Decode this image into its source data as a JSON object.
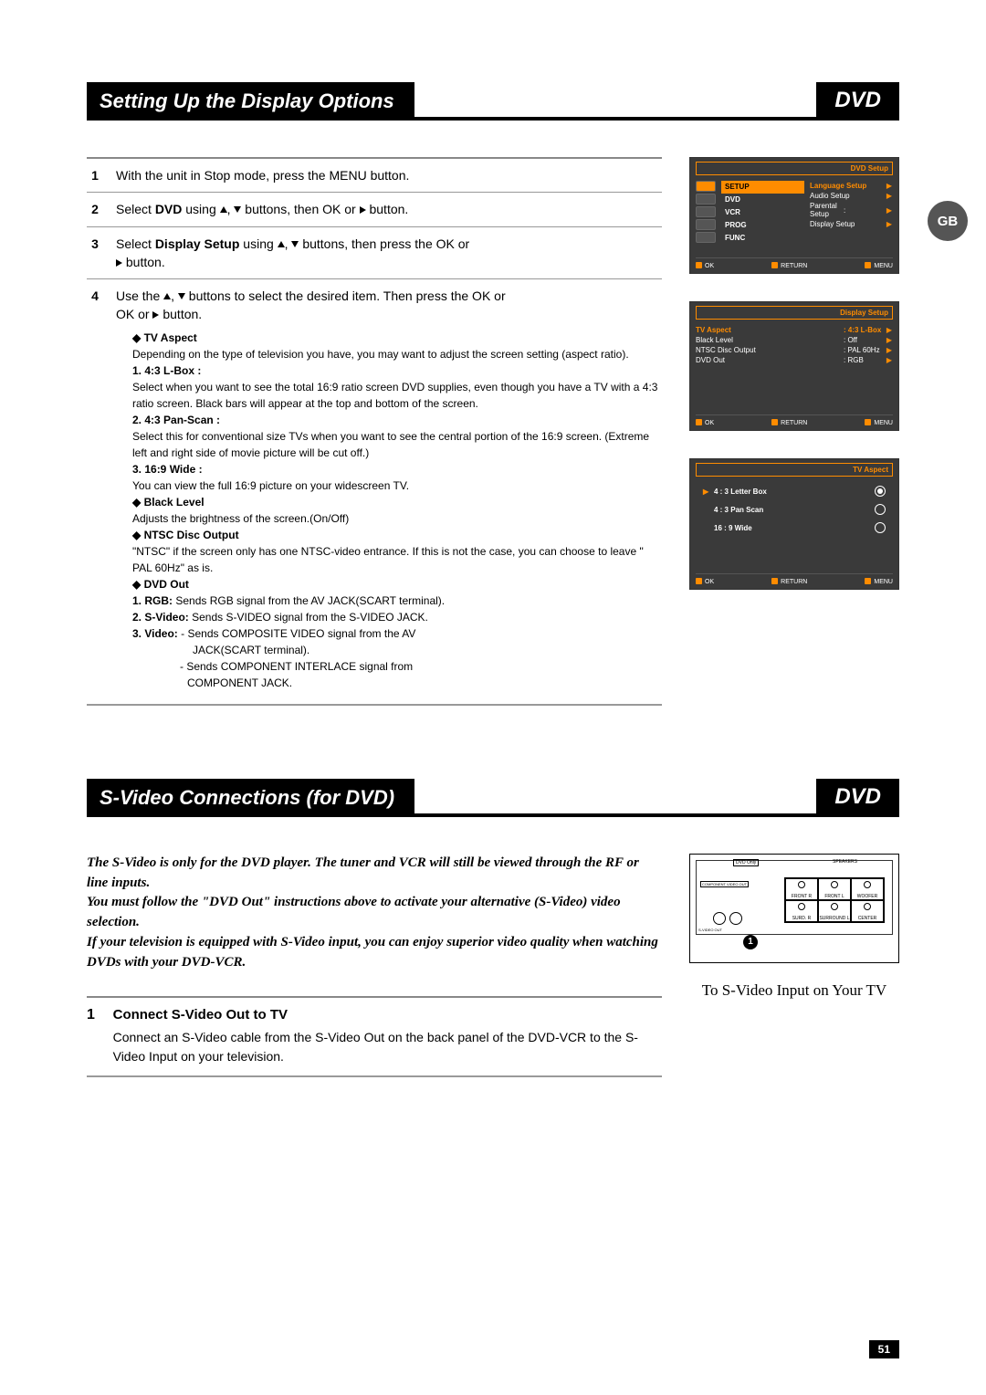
{
  "header1": {
    "title": "Setting Up the Display Options",
    "dvd": "DVD"
  },
  "gb_badge": "GB",
  "steps": [
    {
      "num": "1",
      "text": "With the unit in Stop mode, press the MENU button."
    },
    {
      "num": "2",
      "text_pre": "Select ",
      "bold": "DVD",
      "text_mid": " using ",
      "text_post": " buttons, then OK or ",
      "text_end": " button."
    },
    {
      "num": "3",
      "text_pre": "Select ",
      "bold": "Display Setup",
      "text_mid": " using ",
      "text_post": " buttons, then press the OK or ",
      "text_end": " button."
    },
    {
      "num": "4",
      "text_pre": "Use the ",
      "text_mid": " buttons to select the desired item. Then press the OK or ",
      "text_end": " button."
    }
  ],
  "detail": {
    "tvaspect": {
      "title": "◆ TV Aspect",
      "desc": "Depending on the type of television you have, you may want to adjust the screen setting (aspect ratio)."
    },
    "lbox": {
      "title": "1. 4:3 L-Box :",
      "desc": "Select when you want to see the total 16:9 ratio screen DVD supplies, even though you have a TV with a 4:3 ratio screen. Black bars will appear at the top and bottom of the screen."
    },
    "panscan": {
      "title": "2. 4:3 Pan-Scan :",
      "desc": "Select this for conventional size TVs when you want to see the central portion of the 16:9 screen. (Extreme left and right side of movie picture will be cut off.)"
    },
    "wide": {
      "title": "3. 16:9 Wide :",
      "desc": "You can view the full 16:9 picture on your widescreen TV."
    },
    "black": {
      "title": "◆ Black Level",
      "desc": "Adjusts the brightness of the screen.(On/Off)"
    },
    "ntsc": {
      "title": "◆ NTSC Disc Output",
      "desc": "\"NTSC\" if the screen only has one NTSC-video entrance. If this is not the case, you can choose to leave \" PAL 60Hz\" as is."
    },
    "dvdout": {
      "title": "◆ DVD Out",
      "rgb": {
        "label": "1. RGB:",
        "text": " Sends RGB signal from the AV JACK(SCART terminal)."
      },
      "svideo": {
        "label": "2. S-Video:",
        "text": " Sends S-VIDEO signal from the S-VIDEO JACK."
      },
      "video": {
        "label": "3. Video:",
        "l1": " -  Sends COMPOSITE VIDEO signal from the AV",
        "l2": "JACK(SCART terminal).",
        "l3": "-  Sends COMPONENT INTERLACE signal from",
        "l4": "COMPONENT JACK."
      }
    }
  },
  "osd1": {
    "header": "DVD Setup",
    "tabs": [
      "SETUP",
      "DVD",
      "VCR",
      "PROG",
      "FUNC"
    ],
    "rows": [
      {
        "label": "Language Setup",
        "val": "",
        "arrow": "▶"
      },
      {
        "label": "Audio Setup",
        "val": "",
        "arrow": "▶"
      },
      {
        "label": "Parental Setup",
        "val": ":",
        "arrow": "▶"
      },
      {
        "label": "Display Setup",
        "val": "",
        "arrow": "▶"
      }
    ],
    "footer": {
      "ok": "OK",
      "return": "RETURN",
      "menu": "MENU"
    }
  },
  "osd2": {
    "header": "Display Setup",
    "rows": [
      {
        "label": "TV Aspect",
        "val": ": 4:3 L-Box",
        "arrow": "▶"
      },
      {
        "label": "Black Level",
        "val": ": Off",
        "arrow": "▶"
      },
      {
        "label": "NTSC Disc Output",
        "val": ": PAL 60Hz",
        "arrow": "▶"
      },
      {
        "label": "DVD Out",
        "val": ": RGB",
        "arrow": "▶"
      }
    ],
    "footer": {
      "ok": "OK",
      "return": "RETURN",
      "menu": "MENU"
    }
  },
  "osd3": {
    "header": "TV Aspect",
    "opts": [
      {
        "label": "4 : 3  Letter Box",
        "sel": true
      },
      {
        "label": "4 : 3 Pan Scan",
        "sel": false
      },
      {
        "label": "16 : 9 Wide",
        "sel": false
      }
    ],
    "footer": {
      "ok": "OK",
      "return": "RETURN",
      "menu": "MENU"
    }
  },
  "header2": {
    "title": "S-Video Connections (for DVD)",
    "dvd": "DVD"
  },
  "intro": {
    "p1": "The S-Video is only for the DVD player. The tuner and VCR will still be viewed through the RF or line inputs.",
    "p2": "You must follow the \"DVD Out\" instructions above to activate your alternative (S-Video) video selection.",
    "p3": "If your television is equipped with S-Video input, you can enjoy superior video quality when watching DVDs with your DVD-VCR."
  },
  "svideo_step": {
    "num": "1",
    "title": "Connect S-Video Out to TV",
    "desc": "Connect an S-Video cable from the S-Video Out on the back panel of the DVD-VCR to the S-Video Input on your television."
  },
  "diagram": {
    "speakers_label": "SPEAKERS",
    "sp": [
      "FRONT R",
      "FRONT L",
      "WOOFER",
      "SURD. R",
      "SURROUND L",
      "CENTER"
    ],
    "dvd_only": "DVD Only",
    "component": "COMPONENT VIDEO OUT",
    "svideo": "S-VIDEO OUT",
    "circ": "1",
    "caption": "To S-Video Input on Your TV"
  },
  "page_num": "51"
}
